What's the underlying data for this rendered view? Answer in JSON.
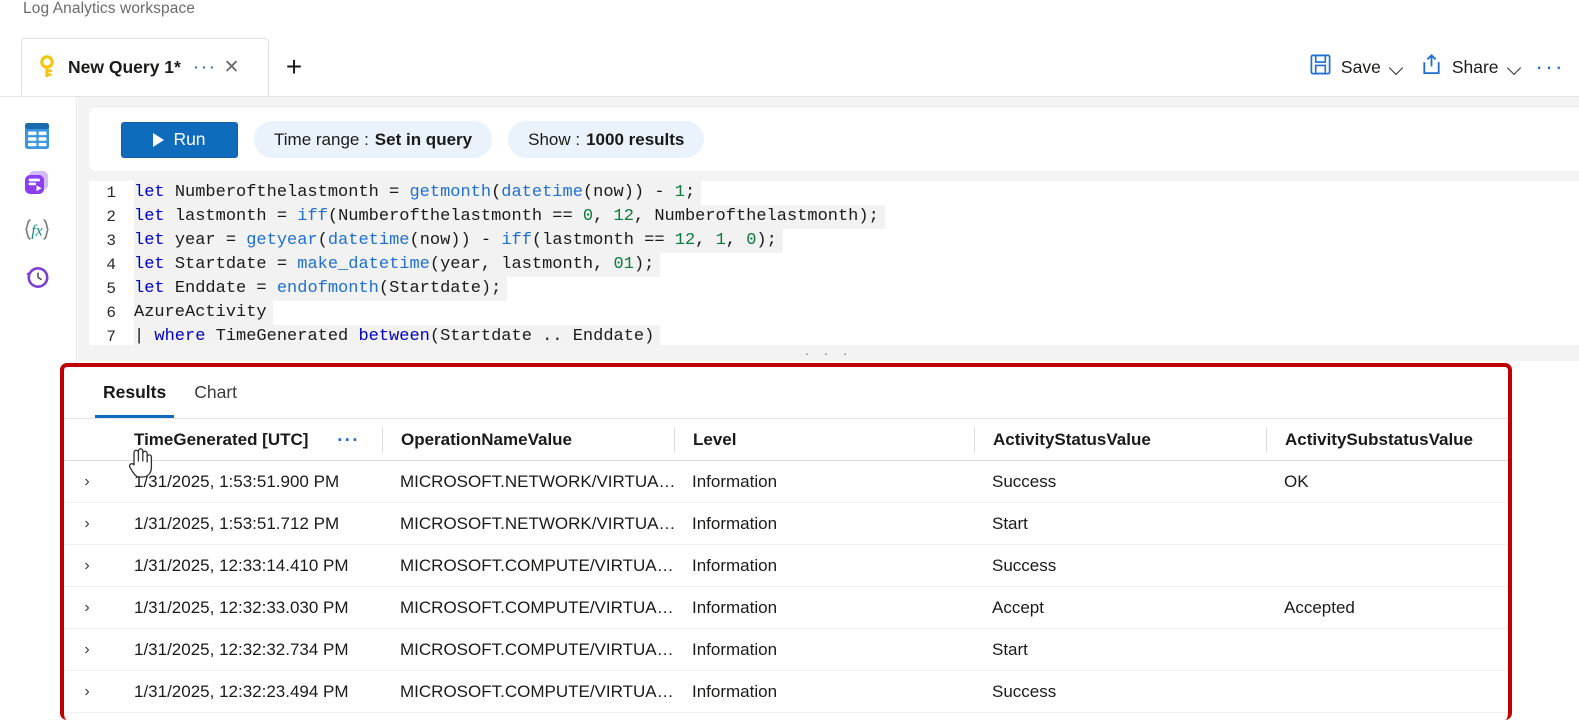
{
  "breadcrumb": "Log Analytics workspace",
  "tab": {
    "icon": "key-icon",
    "title": "New Query 1*",
    "menu_dots": "···",
    "close": "✕",
    "new_tab": "+"
  },
  "toolbar": {
    "save_label": "Save",
    "share_label": "Share",
    "more_dots": "···",
    "save_icon": "save-floppy-icon",
    "share_icon": "share-upload-icon"
  },
  "rail": {
    "items": [
      {
        "name": "tables-icon",
        "title": "Tables"
      },
      {
        "name": "queries-icon",
        "title": "Queries"
      },
      {
        "name": "functions-icon",
        "title": "Functions"
      },
      {
        "name": "history-icon",
        "title": "Query history"
      }
    ]
  },
  "query_toolbar": {
    "run_label": "Run",
    "time_range_label": "Time range :",
    "time_range_value": "Set in query",
    "show_label": "Show :",
    "show_value": "1000 results"
  },
  "editor": {
    "lines": [
      {
        "n": "1",
        "text": "let Numberofthelastmonth = getmonth(datetime(now)) - 1;"
      },
      {
        "n": "2",
        "text": "let lastmonth = iff(Numberofthelastmonth == 0, 12, Numberofthelastmonth);"
      },
      {
        "n": "3",
        "text": "let year = getyear(datetime(now)) - iff(lastmonth == 12, 1, 0);"
      },
      {
        "n": "4",
        "text": "let Startdate = make_datetime(year, lastmonth, 01);"
      },
      {
        "n": "5",
        "text": "let Enddate = endofmonth(Startdate);"
      },
      {
        "n": "6",
        "text": "AzureActivity"
      },
      {
        "n": "7",
        "text": "| where TimeGenerated between(Startdate .. Enddate)"
      }
    ]
  },
  "splitter": {
    "dots": "· · ·"
  },
  "results": {
    "tabs": [
      {
        "label": "Results",
        "active": true
      },
      {
        "label": "Chart",
        "active": false
      }
    ],
    "columns": [
      "TimeGenerated [UTC]",
      "OperationNameValue",
      "Level",
      "ActivityStatusValue",
      "ActivitySubstatusValue"
    ],
    "header_dots": "···",
    "expand_chevron": "›",
    "rows": [
      {
        "time": "1/31/2025, 1:53:51.900 PM",
        "operation": "MICROSOFT.NETWORK/VIRTUA…",
        "level": "Information",
        "status": "Success",
        "substatus": "OK"
      },
      {
        "time": "1/31/2025, 1:53:51.712 PM",
        "operation": "MICROSOFT.NETWORK/VIRTUA…",
        "level": "Information",
        "status": "Start",
        "substatus": ""
      },
      {
        "time": "1/31/2025, 12:33:14.410 PM",
        "operation": "MICROSOFT.COMPUTE/VIRTUA…",
        "level": "Information",
        "status": "Success",
        "substatus": ""
      },
      {
        "time": "1/31/2025, 12:32:33.030 PM",
        "operation": "MICROSOFT.COMPUTE/VIRTUA…",
        "level": "Information",
        "status": "Accept",
        "substatus": "Accepted"
      },
      {
        "time": "1/31/2025, 12:32:32.734 PM",
        "operation": "MICROSOFT.COMPUTE/VIRTUA…",
        "level": "Information",
        "status": "Start",
        "substatus": ""
      },
      {
        "time": "1/31/2025, 12:32:23.494 PM",
        "operation": "MICROSOFT.COMPUTE/VIRTUA…",
        "level": "Information",
        "status": "Success",
        "substatus": ""
      }
    ]
  },
  "colors": {
    "accent_blue": "#0f6cbd",
    "annotation_red": "#c00000",
    "pill_bg": "#eaf3fb",
    "keyword_blue": "#0000c0",
    "function_blue": "#1f6fd0",
    "number_green": "#0a7a3d",
    "key_yellow": "#f2c511",
    "tables_icon_blue": "#3a96dd",
    "queries_icon_purple": "#8b5cf6",
    "functions_icon_teal": "#109090",
    "history_icon_purple": "#7b3fd4"
  }
}
